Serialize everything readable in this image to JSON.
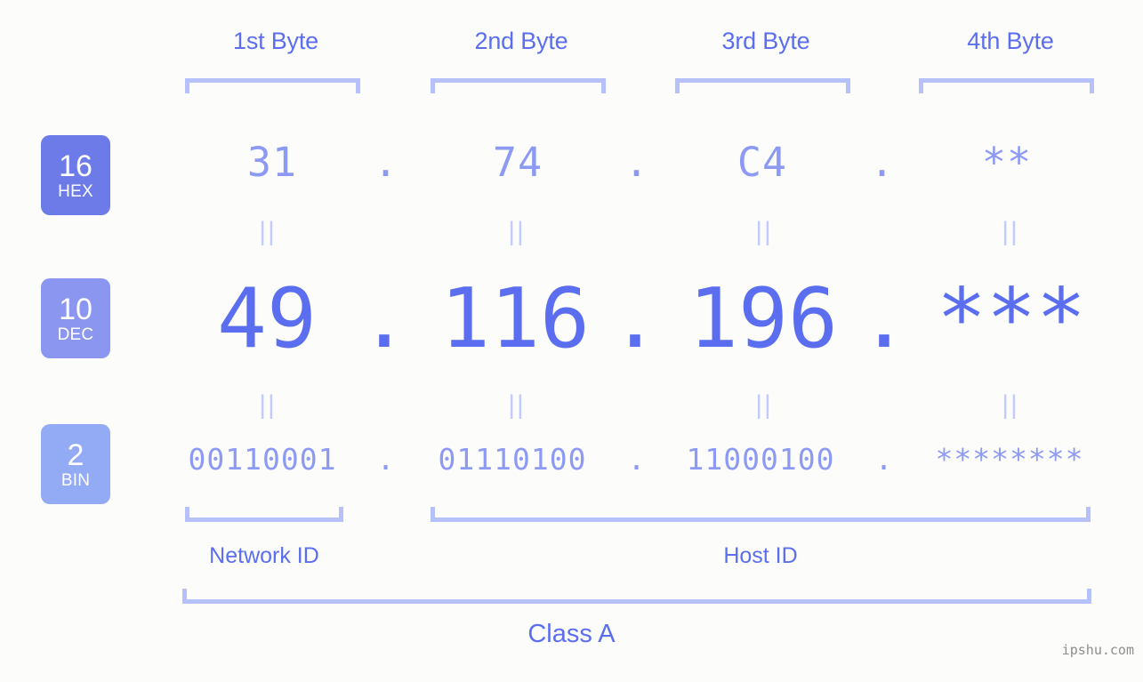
{
  "page": {
    "background_color": "#fcfdfb",
    "accent_color": "#5b6ef0",
    "muted_color": "#8d9af4",
    "bracket_color": "#b6c0fb",
    "watermark": "ipshu.com"
  },
  "byte_headers": [
    {
      "label": "1st Byte"
    },
    {
      "label": "2nd Byte"
    },
    {
      "label": "3rd Byte"
    },
    {
      "label": "4th Byte"
    }
  ],
  "bases": [
    {
      "radix": "16",
      "name": "HEX",
      "color": "#6d7be8"
    },
    {
      "radix": "10",
      "name": "DEC",
      "color": "#8b96f0"
    },
    {
      "radix": "2",
      "name": "BIN",
      "color": "#93aaf5"
    }
  ],
  "rows": {
    "hex": {
      "base_label": "HEX",
      "values": [
        "31",
        "74",
        "C4",
        "**"
      ],
      "separator": "."
    },
    "dec": {
      "base_label": "DEC",
      "values": [
        "49",
        "116",
        "196",
        "***"
      ],
      "separator": "."
    },
    "bin": {
      "base_label": "BIN",
      "values": [
        "00110001",
        "01110100",
        "11000100",
        "********"
      ],
      "separator": "."
    }
  },
  "equals_marks": {
    "glyph": "||",
    "count_per_row": 4
  },
  "sections": [
    {
      "label": "Network ID"
    },
    {
      "label": "Host ID"
    }
  ],
  "class": {
    "label": "Class A"
  }
}
